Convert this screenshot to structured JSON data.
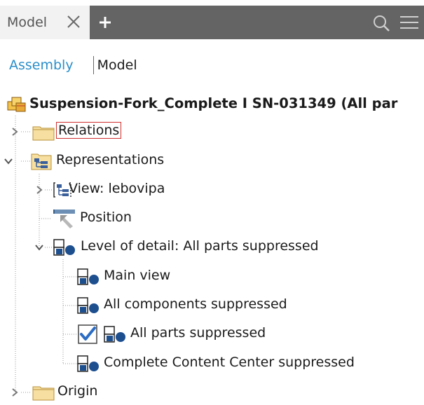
{
  "tabs": {
    "active_label": "Model"
  },
  "browser_mode": {
    "assembly_label": "Assembly",
    "model_label": "Model"
  },
  "tree": {
    "root": {
      "label": "Suspension-Fork_Complete I SN-031349 (All par",
      "icon": "assembly-icon"
    },
    "relations": {
      "label": "Relations",
      "icon": "folder-icon",
      "expander": "collapsed"
    },
    "representations": {
      "label": "Representations",
      "icon": "representations-icon",
      "expander": "expanded"
    },
    "view": {
      "label": "View: lebovipa",
      "icon": "view-representation-icon",
      "expander": "collapsed"
    },
    "position": {
      "label": "Position",
      "icon": "position-icon"
    },
    "level_of_detail": {
      "label": "Level of detail: All parts suppressed",
      "icon": "level-of-detail-icon",
      "expander": "expanded"
    },
    "lod_items": [
      {
        "label": "Main view",
        "icon": "level-of-detail-icon",
        "active": false
      },
      {
        "label": "All components suppressed",
        "icon": "level-of-detail-icon",
        "active": false
      },
      {
        "label": "All parts suppressed",
        "icon": "level-of-detail-icon",
        "active": true
      },
      {
        "label": "Complete Content Center suppressed",
        "icon": "level-of-detail-icon",
        "active": false
      }
    ],
    "origin": {
      "label": "Origin",
      "icon": "folder-icon",
      "expander": "collapsed"
    }
  },
  "colors": {
    "tab_bar": "#646464",
    "active_tab": "#f2f2f2",
    "assembly_link": "#2a8ec9",
    "selection_border": "#d03030",
    "folder_fill": "#f6dfa0",
    "lod_icon_blue": "#1d4f8f",
    "check_blue": "#2b6cc4"
  }
}
